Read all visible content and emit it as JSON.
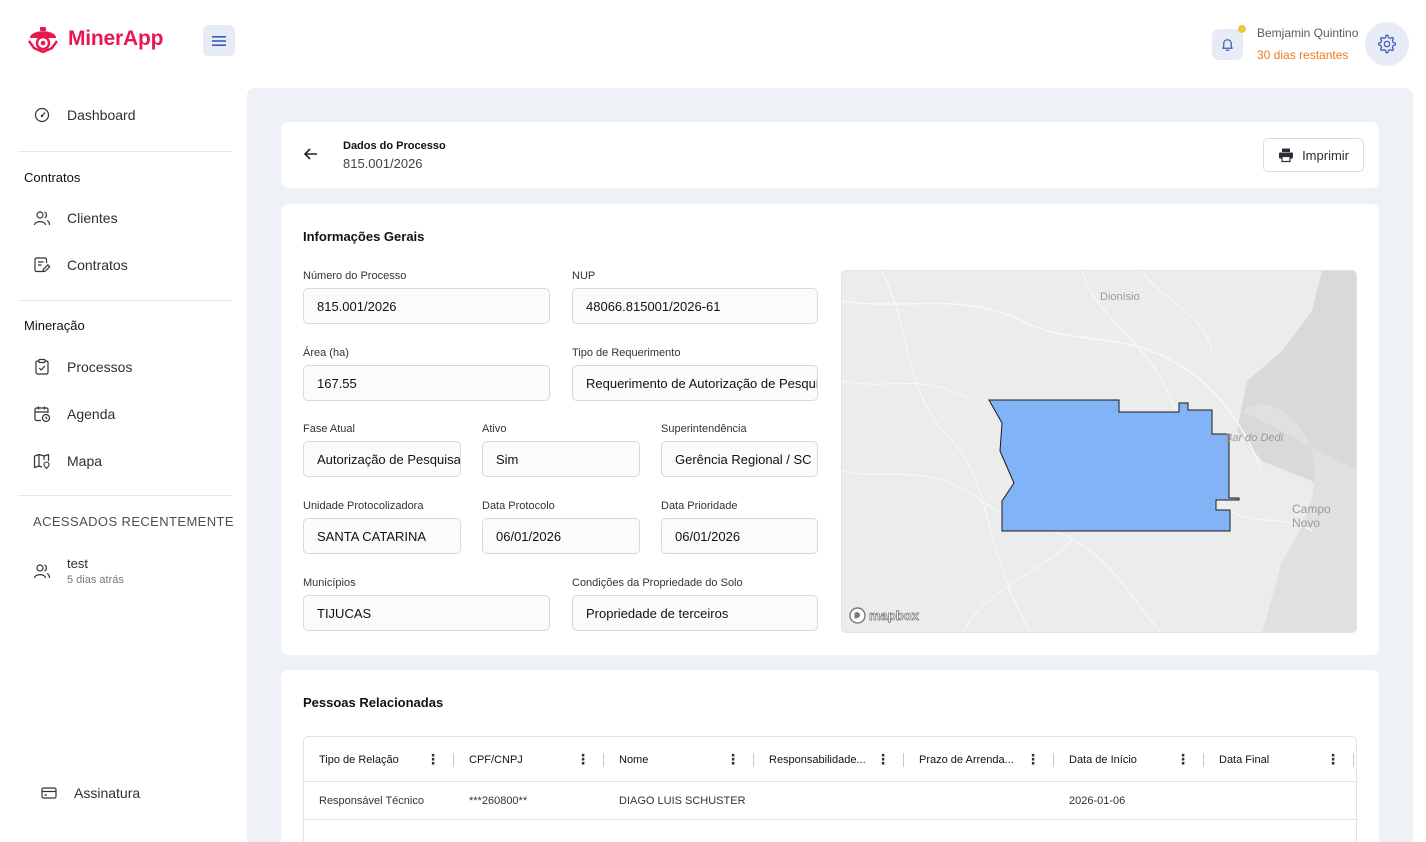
{
  "app": {
    "name": "MinerApp",
    "brand_color": "#e8184f"
  },
  "user": {
    "name": "Bemjamin Quintino",
    "days_left": "30 dias restantes"
  },
  "sidebar": {
    "dashboard": "Dashboard",
    "contracts_section": "Contratos",
    "clients": "Clientes",
    "contracts": "Contratos",
    "mining_section": "Mineração",
    "processes": "Processos",
    "agenda": "Agenda",
    "map": "Mapa",
    "recent_section": "ACESSADOS RECENTEMENTE",
    "recent_item": {
      "title": "test",
      "subtitle": "5 dias atrás"
    },
    "subscription": "Assinatura"
  },
  "header": {
    "title": "Dados do Processo",
    "process_number": "815.001/2026",
    "print_label": "Imprimir"
  },
  "info": {
    "title": "Informações Gerais",
    "fields": {
      "numero_label": "Número do Processo",
      "numero": "815.001/2026",
      "nup_label": "NUP",
      "nup": "48066.815001/2026-61",
      "area_label": "Área (ha)",
      "area": "167.55",
      "tipo_label": "Tipo de Requerimento",
      "tipo": "Requerimento de Autorização de Pesquisa",
      "fase_label": "Fase Atual",
      "fase": "Autorização de Pesquisa",
      "ativo_label": "Ativo",
      "ativo": "Sim",
      "super_label": "Superintendência",
      "super": "Gerência Regional / SC",
      "unidade_label": "Unidade Protocolizadora",
      "unidade": "SANTA CATARINA",
      "data_protocolo_label": "Data Protocolo",
      "data_protocolo": "06/01/2026",
      "data_prioridade_label": "Data Prioridade",
      "data_prioridade": "06/01/2026",
      "municipios_label": "Municípios",
      "municipios": "TIJUCAS",
      "condicoes_label": "Condições da Propriedade do Solo",
      "condicoes": "Propriedade de terceiros"
    },
    "map": {
      "labels": [
        "Dionísio",
        "Bar do Dedi",
        "Campo Novo"
      ],
      "attribution": "mapbox",
      "polygon_color": "#82b3f7"
    }
  },
  "people": {
    "title": "Pessoas Relacionadas",
    "columns": [
      "Tipo de Relação",
      "CPF/CNPJ",
      "Nome",
      "Responsabilidade...",
      "Prazo de Arrenda...",
      "Data de Início",
      "Data Final"
    ],
    "rows": [
      [
        "Responsável Técnico",
        "***260800**",
        "DIAGO LUIS SCHUSTER",
        "",
        "",
        "2026-01-06",
        ""
      ]
    ]
  }
}
